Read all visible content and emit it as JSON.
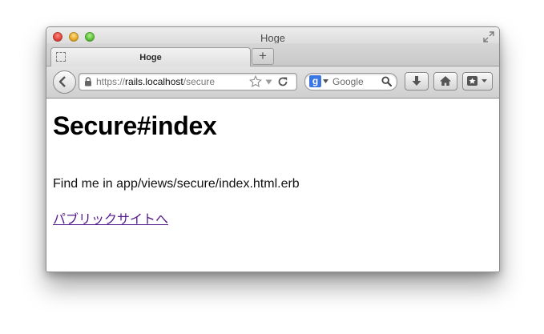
{
  "window": {
    "title": "Hoge"
  },
  "tab": {
    "label": "Hoge",
    "new_tab": "+"
  },
  "address_bar": {
    "scheme": "https://",
    "host": "rails.localhost",
    "path": "/secure"
  },
  "search": {
    "engine_letter": "g",
    "placeholder": "Google"
  },
  "page": {
    "heading": "Secure#index",
    "paragraph": "Find me in app/views/secure/index.html.erb",
    "link": "パブリックサイトへ"
  },
  "colors": {
    "visited_link": "#551a8b",
    "search_engine_badge": "#3b76e4"
  },
  "icons": [
    "close-icon",
    "minimize-icon",
    "zoom-icon",
    "fullscreen-icon",
    "tab-placeholder-icon",
    "back-arrow-icon",
    "lock-icon",
    "star-icon",
    "chevron-down-icon",
    "reload-icon",
    "search-icon",
    "download-icon",
    "home-icon",
    "bookmarks-icon"
  ]
}
